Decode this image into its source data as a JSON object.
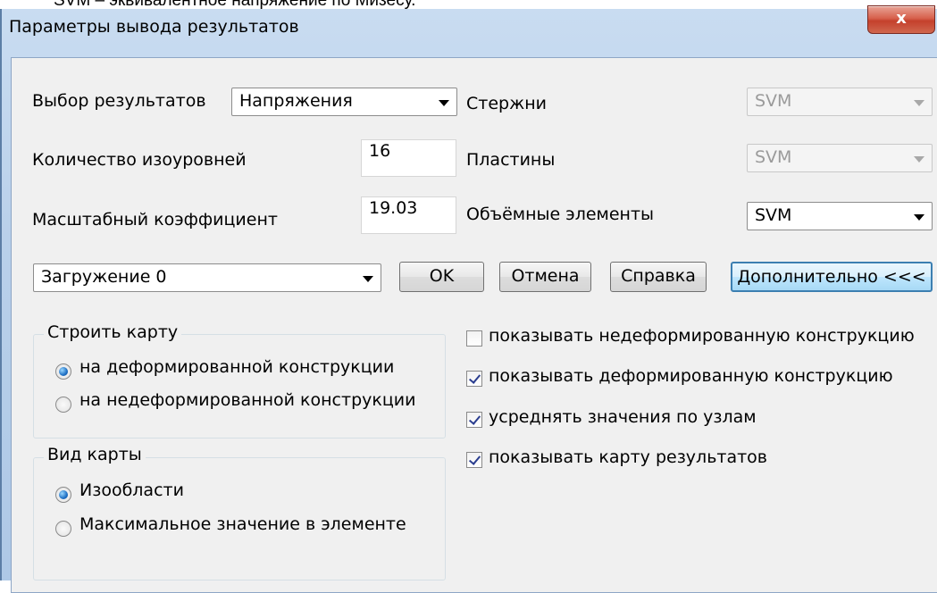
{
  "background_text": "SVM – эквивалентное напряжение по Мизесу.",
  "dialog": {
    "title": "Параметры вывода результатов",
    "close_label": "x"
  },
  "results": {
    "label": "Выбор результатов",
    "selected": "Напряжения"
  },
  "levels": {
    "label": "Количество изоуровней",
    "value": "16"
  },
  "scale": {
    "label": "Масштабный коэффициент",
    "value": "19.03"
  },
  "rods": {
    "label": "Стержни",
    "value": "SVM",
    "enabled": false
  },
  "plates": {
    "label": "Пластины",
    "value": "SVM",
    "enabled": false
  },
  "volumes": {
    "label": "Объёмные элементы",
    "value": "SVM",
    "enabled": true
  },
  "loading": {
    "selected": "Загружение 0"
  },
  "buttons": {
    "ok": "OK",
    "cancel": "Отмена",
    "help": "Справка",
    "more": "Дополнительно <<<"
  },
  "build_map": {
    "title": "Строить карту",
    "options": [
      "на деформированной конструкции",
      "на недеформированной конструкции"
    ],
    "selected_index": 0
  },
  "map_type": {
    "title": "Вид карты",
    "options": [
      "Изообласти",
      "Максимальное значение в элементе"
    ],
    "selected_index": 0
  },
  "checks": [
    {
      "label": "показывать недеформированную конструкцию",
      "checked": false
    },
    {
      "label": "показывать деформированную конструкцию",
      "checked": true
    },
    {
      "label": "усреднять значения по узлам",
      "checked": true
    },
    {
      "label": "показывать карту результатов",
      "checked": true
    }
  ],
  "colors": {
    "title_bar": "#c9dcf1",
    "client": "#f0f0f0",
    "close_button": "#d7604c",
    "default_button_border": "#3c7fb1"
  }
}
